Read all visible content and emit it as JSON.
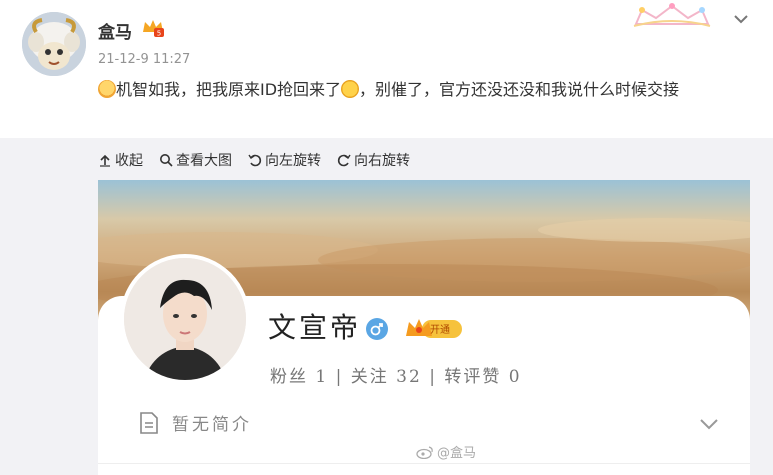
{
  "post": {
    "username": "盒马",
    "timestamp": "21-12-9 11:27",
    "text_part1": "机智如我，把我原来ID抢回来了",
    "text_part2": "，别催了，官方还没还没和我说什么时候交接"
  },
  "toolbar": {
    "collapse_label": "收起",
    "view_large_label": "查看大图",
    "rotate_left_label": "向左旋转",
    "rotate_right_label": "向右旋转"
  },
  "profile": {
    "name": "文宣帝",
    "vip_label": "开通",
    "stats": "粉丝 1 | 关注 32 | 转评赞 0",
    "bio": "暂无简介",
    "watermark": "@盒马"
  },
  "colors": {
    "accent_blue": "#5aa6e4",
    "vip_gold": "#f6c23c"
  }
}
